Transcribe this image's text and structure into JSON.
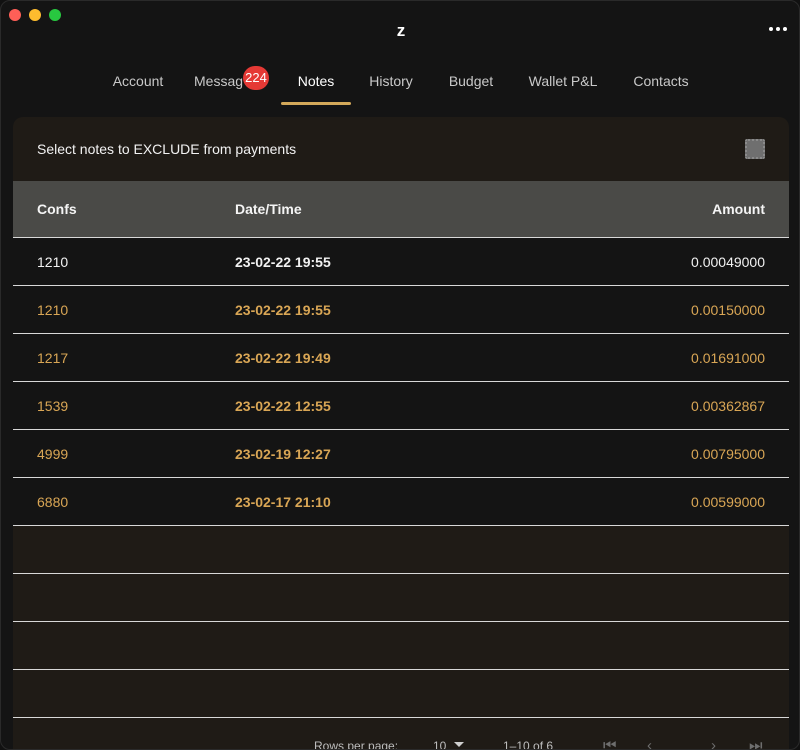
{
  "window": {
    "title": "z",
    "controls": [
      "close",
      "minimize",
      "zoom"
    ]
  },
  "tabs": [
    {
      "label": "Account"
    },
    {
      "label": "Messag"
    },
    {
      "label": "Notes"
    },
    {
      "label": "History"
    },
    {
      "label": "Budget"
    },
    {
      "label": "Wallet P&L"
    },
    {
      "label": "Contacts"
    }
  ],
  "messages_badge": "224",
  "active_tab": "Notes",
  "panel": {
    "title": "Select notes to EXCLUDE from payments"
  },
  "table": {
    "columns": {
      "confs": "Confs",
      "datetime": "Date/Time",
      "amount": "Amount"
    },
    "rows": [
      {
        "confs": "1210",
        "datetime": "23-02-22 19:55",
        "amount": "0.00049000",
        "excluded": false
      },
      {
        "confs": "1210",
        "datetime": "23-02-22 19:55",
        "amount": "0.00150000",
        "excluded": true
      },
      {
        "confs": "1217",
        "datetime": "23-02-22 19:49",
        "amount": "0.01691000",
        "excluded": true
      },
      {
        "confs": "1539",
        "datetime": "23-02-22 12:55",
        "amount": "0.00362867",
        "excluded": true
      },
      {
        "confs": "4999",
        "datetime": "23-02-19 12:27",
        "amount": "0.00795000",
        "excluded": true
      },
      {
        "confs": "6880",
        "datetime": "23-02-17 21:10",
        "amount": "0.00599000",
        "excluded": true
      }
    ]
  },
  "pagination": {
    "rows_per_page_label": "Rows per page:",
    "rows_per_page": "10",
    "range": "1–10 of 6"
  },
  "colors": {
    "accent": "#d4a95a",
    "row_gold": "#d9a655",
    "badge": "#e53935"
  }
}
